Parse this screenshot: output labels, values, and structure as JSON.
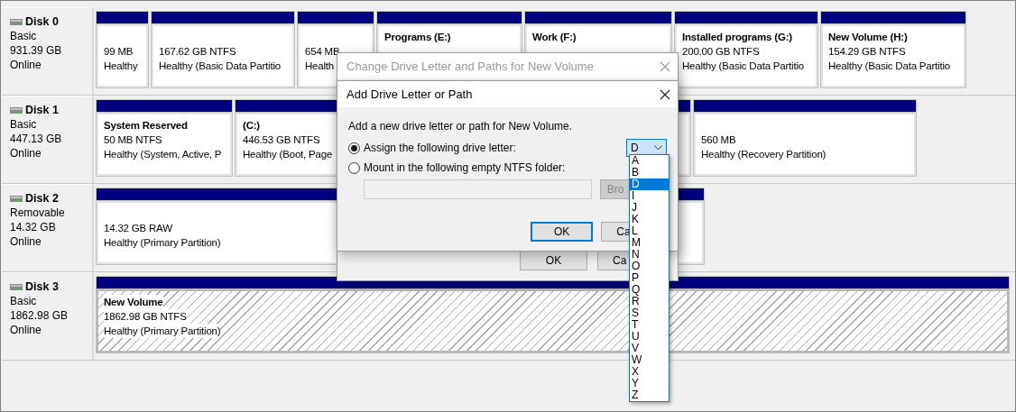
{
  "disks": [
    {
      "name": "Disk 0",
      "type": "Basic",
      "size": "931.39 GB",
      "status": "Online",
      "partitions": [
        {
          "size": "99 MB",
          "health": "Healthy",
          "selected": false
        },
        {
          "size": "167.62 GB NTFS",
          "health": "Healthy (Basic Data Partitio",
          "selected": false
        },
        {
          "size": "654 MB",
          "health": "Health",
          "selected": false
        },
        {
          "title": "Programs  (E:)",
          "selected": false
        },
        {
          "title": "Work  (F:)",
          "selected": false
        },
        {
          "title": "Installed programs  (G:)",
          "size": "200.00 GB NTFS",
          "health": "Healthy (Basic Data Partitio",
          "selected": false
        },
        {
          "title": "New Volume  (H:)",
          "size": "154.29 GB NTFS",
          "health": "Healthy (Basic Data Partitio",
          "selected": false
        }
      ]
    },
    {
      "name": "Disk 1",
      "type": "Basic",
      "size": "447.13 GB",
      "status": "Online",
      "partitions": [
        {
          "title": "System Reserved",
          "size": "50 MB NTFS",
          "health": "Healthy (System, Active, P",
          "selected": false
        },
        {
          "title": " (C:)",
          "size": "446.53 GB NTFS",
          "health": "Healthy (Boot, Page",
          "selected": false
        },
        {
          "size": "560 MB",
          "health": "Healthy (Recovery Partition)",
          "selected": false
        }
      ]
    },
    {
      "name": "Disk 2",
      "type": "Removable",
      "size": "14.32 GB",
      "status": "Online",
      "partitions": [
        {
          "size": "14.32 GB RAW",
          "health": "Healthy (Primary Partition)",
          "selected": false
        }
      ]
    },
    {
      "name": "Disk 3",
      "type": "Basic",
      "size": "1862.98 GB",
      "status": "Online",
      "partitions": [
        {
          "title": "New Volume",
          "size": "1862.98 GB NTFS",
          "health": "Healthy (Primary Partition)",
          "selected": true
        }
      ]
    }
  ],
  "outer_dialog": {
    "title": "Change Drive Letter and Paths for New Volume",
    "buttons": [
      {
        "label": "OK",
        "focused": false
      },
      {
        "label": "Ca",
        "focused": false
      }
    ]
  },
  "dialog": {
    "title": "Add Drive Letter or Path",
    "prompt": "Add a new drive letter or path for New Volume.",
    "options": [
      {
        "label": "Assign the following drive letter:",
        "selected": true
      },
      {
        "label": "Mount in the following empty NTFS folder:",
        "selected": false
      }
    ],
    "drive_letter": "D",
    "browse_button": {
      "label": "Bro",
      "disabled": true
    },
    "buttons": [
      {
        "label": "OK",
        "focused": true
      },
      {
        "label": "Ca",
        "focused": false
      }
    ]
  },
  "letter_list": [
    {
      "label": "A",
      "selected": false
    },
    {
      "label": "B",
      "selected": false
    },
    {
      "label": "D",
      "selected": true
    },
    {
      "label": "I",
      "selected": false
    },
    {
      "label": "J",
      "selected": false
    },
    {
      "label": "K",
      "selected": false
    },
    {
      "label": "L",
      "selected": false
    },
    {
      "label": "M",
      "selected": false
    },
    {
      "label": "N",
      "selected": false
    },
    {
      "label": "O",
      "selected": false
    },
    {
      "label": "P",
      "selected": false
    },
    {
      "label": "Q",
      "selected": false
    },
    {
      "label": "R",
      "selected": false
    },
    {
      "label": "S",
      "selected": false
    },
    {
      "label": "T",
      "selected": false
    },
    {
      "label": "U",
      "selected": false
    },
    {
      "label": "V",
      "selected": false
    },
    {
      "label": "W",
      "selected": false
    },
    {
      "label": "X",
      "selected": false
    },
    {
      "label": "Y",
      "selected": false
    },
    {
      "label": "Z",
      "selected": false
    }
  ]
}
